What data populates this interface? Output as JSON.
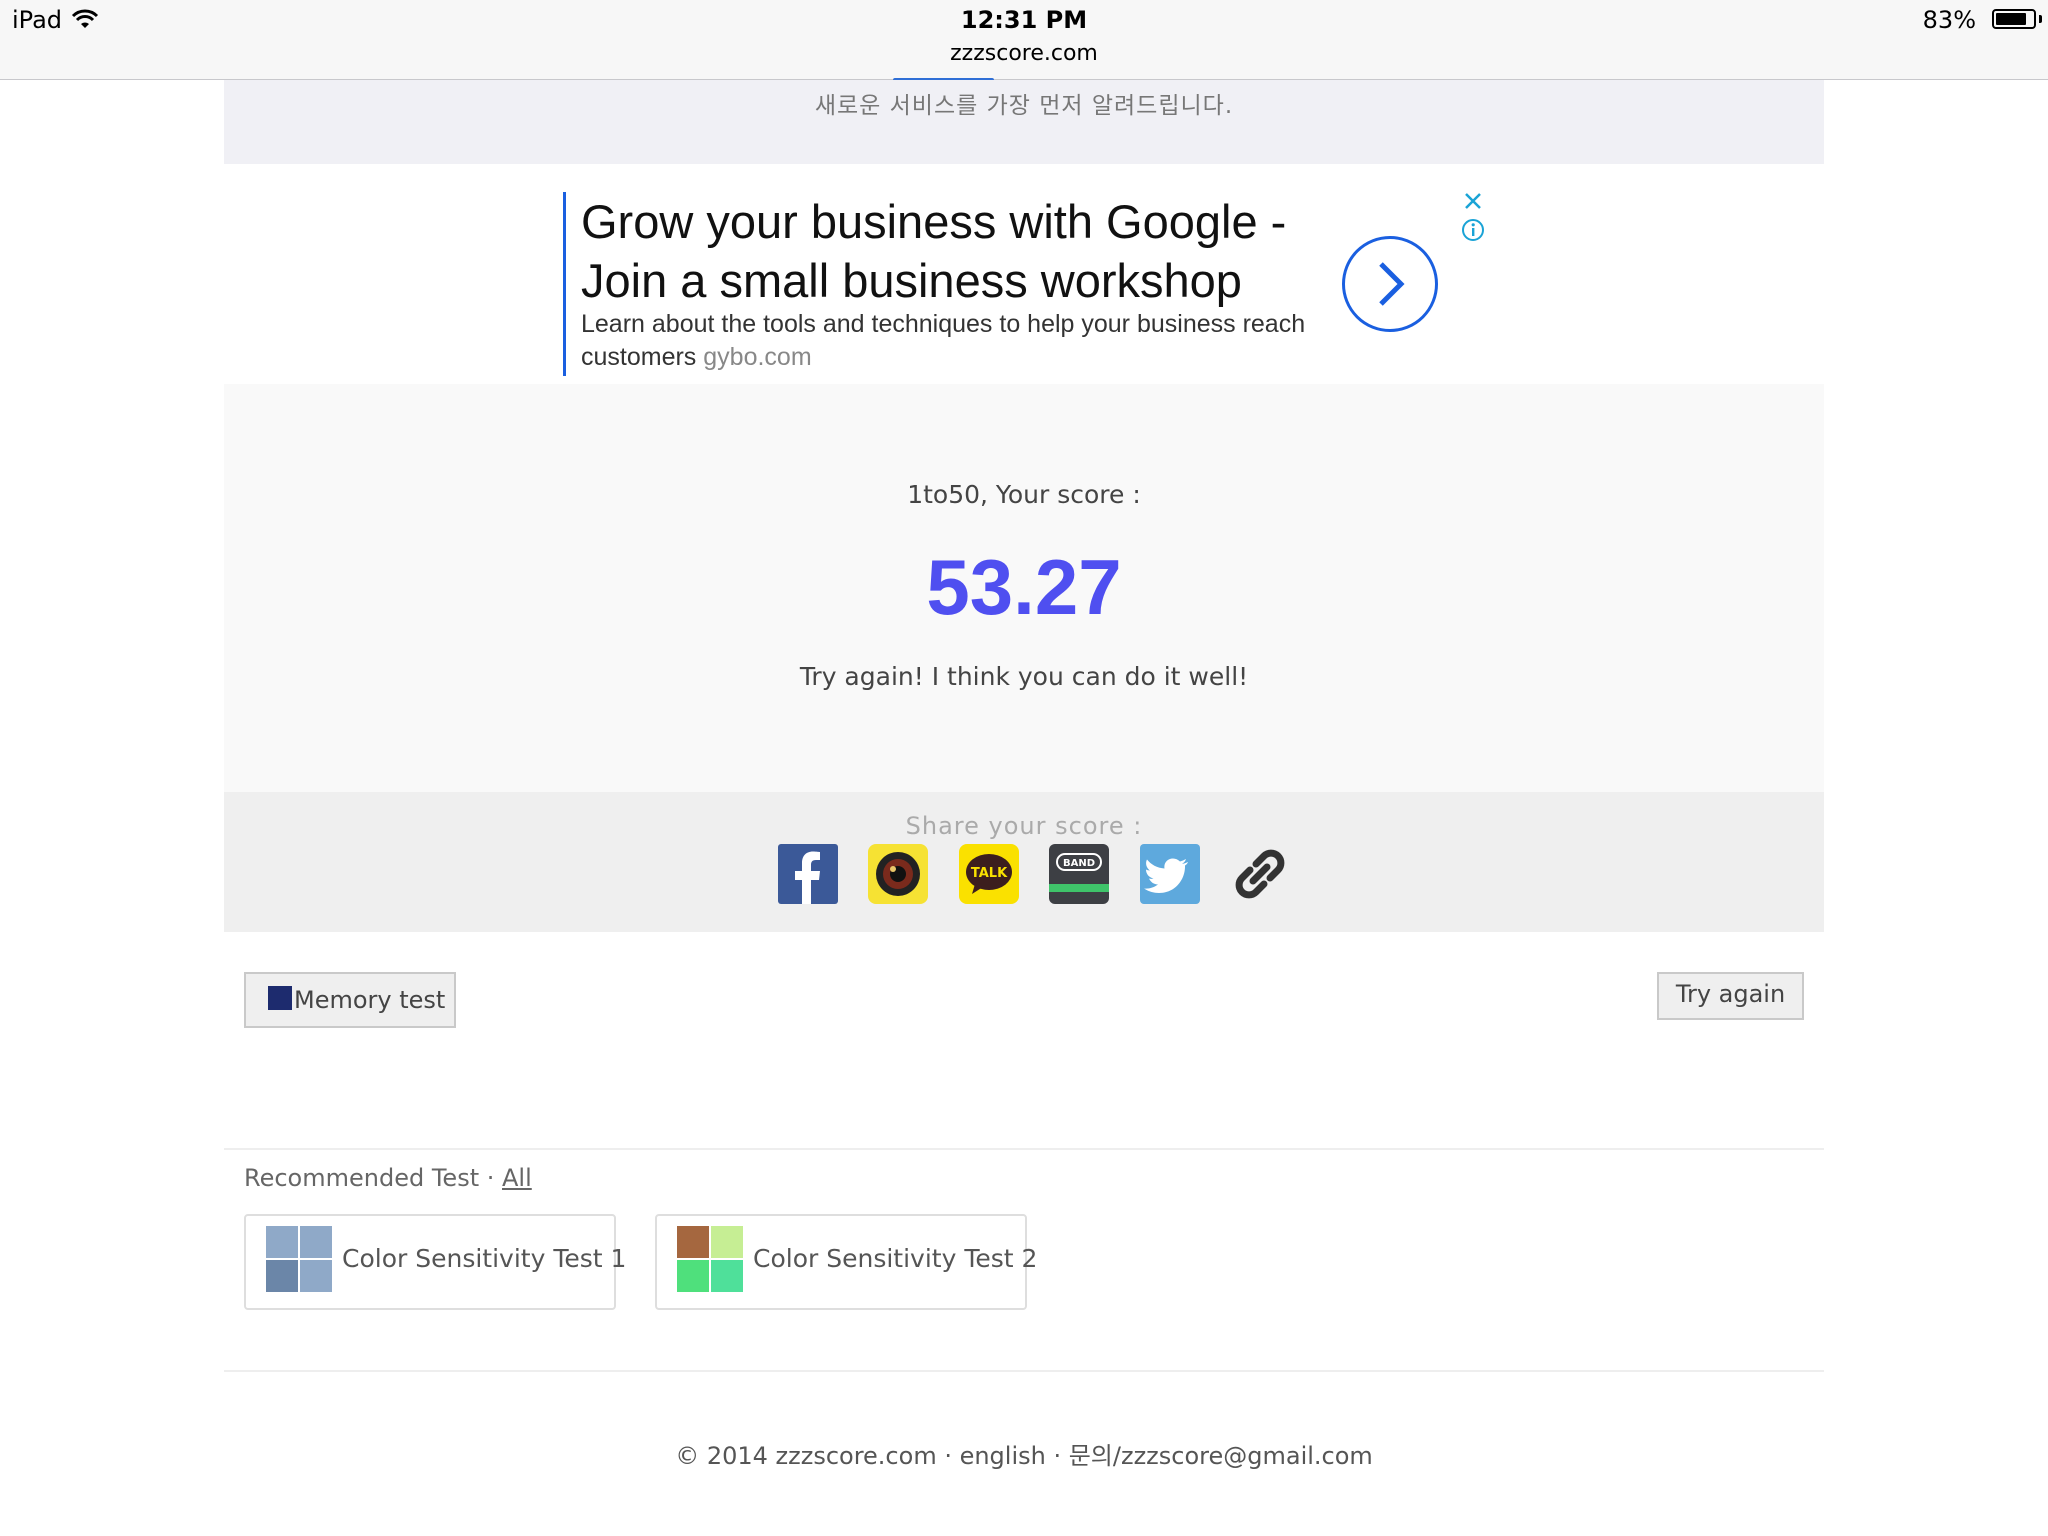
{
  "statusbar": {
    "device": "iPad",
    "time": "12:31 PM",
    "battery": "83%",
    "battery_level": 0.83
  },
  "browser": {
    "url": "zzzscore.com"
  },
  "signup_banner": {
    "text": "새로운 서비스를 가장 먼저 알려드립니다."
  },
  "ad": {
    "headline": "Grow your business with Google - Join a small business workshop",
    "body": "Learn about the tools and techniques to help your business reach customers",
    "domain": "gybo.com"
  },
  "score": {
    "label": "1to50, Your score :",
    "value": "53.27",
    "message": "Try again! I think you can do it well!"
  },
  "share": {
    "label": "Share your score :",
    "talk_text": "TALK",
    "band_text": "BAND"
  },
  "buttons": {
    "memory_test": "Memory test",
    "try_again": "Try again"
  },
  "recommended": {
    "header": "Recommended Test ·",
    "all_link": "All",
    "items": [
      {
        "label": "Color Sensitivity Test 1",
        "colors": [
          "#8fa9c8",
          "#8fa9c8",
          "#6b86a8",
          "#8fa9c8"
        ]
      },
      {
        "label": "Color Sensitivity Test 2",
        "colors": [
          "#a5673f",
          "#c6ee94",
          "#4fe07c",
          "#4fe09a"
        ]
      }
    ]
  },
  "footer": {
    "text": "© 2014 zzzscore.com · english · 문의/zzzscore@gmail.com"
  },
  "colors": {
    "score": "#4f4ff0",
    "ad_accent": "#1a5fe0",
    "facebook": "#3b5998",
    "twitter": "#5ea9dd"
  }
}
